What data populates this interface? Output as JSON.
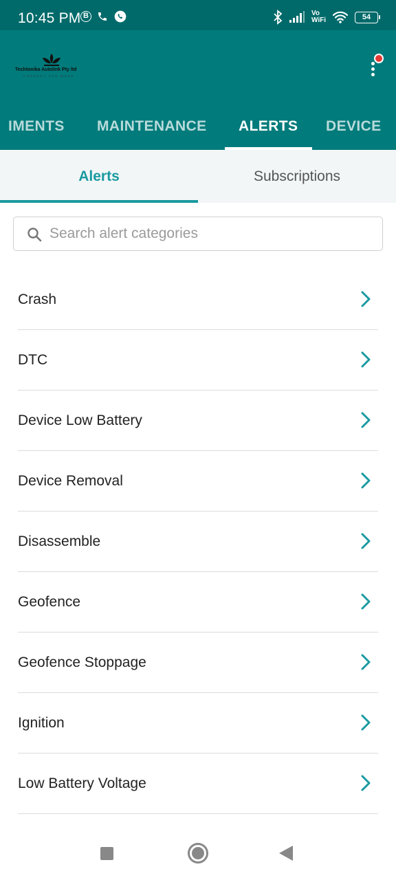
{
  "status_bar": {
    "time": "10:45 PM",
    "b_icon": "B",
    "vowifi_top": "Vo",
    "vowifi_bottom": "WiFi",
    "battery": "54"
  },
  "app_bar": {
    "logo_title": "Techtonika Autolink Pty ltd",
    "logo_tagline": "CONNECT YOU MORE",
    "colors": {
      "primary": "#017b7b",
      "status_bar": "#006a6a",
      "accent": "#1a9aa0",
      "badge": "#e53935"
    }
  },
  "tabs": [
    {
      "label": "IMENTS"
    },
    {
      "label": "MAINTENANCE"
    },
    {
      "label": "ALERTS"
    },
    {
      "label": "DEVICE"
    }
  ],
  "subtabs": {
    "alerts": "Alerts",
    "subscriptions": "Subscriptions"
  },
  "search": {
    "placeholder": "Search alert categories",
    "value": ""
  },
  "alert_categories": [
    {
      "label": "Crash"
    },
    {
      "label": "DTC"
    },
    {
      "label": "Device Low Battery"
    },
    {
      "label": "Device Removal"
    },
    {
      "label": "Disassemble"
    },
    {
      "label": "Geofence"
    },
    {
      "label": "Geofence Stoppage"
    },
    {
      "label": "Ignition"
    },
    {
      "label": "Low Battery Voltage"
    }
  ],
  "icons": {
    "status_left": [
      "b-circle-icon",
      "phone-icon",
      "whatsapp-icon"
    ],
    "status_right": [
      "bluetooth-icon",
      "signal-icon",
      "vowifi-icon",
      "wifi-icon",
      "battery-icon"
    ],
    "menu": "more-vert-icon",
    "search": "search-icon",
    "row": "chevron-right-icon",
    "nav": [
      "recents-square-icon",
      "home-circle-icon",
      "back-triangle-icon"
    ]
  }
}
